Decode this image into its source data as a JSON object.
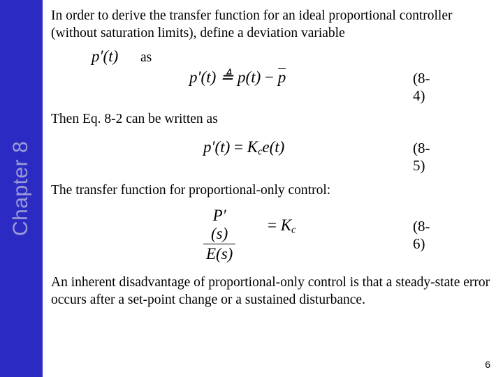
{
  "sidebar": {
    "chapter_label": "Chapter 8",
    "color": "#2b2bc4",
    "text_color": "#9a9ad8"
  },
  "slide": {
    "paragraph_1": "In order to derive the transfer function for an ideal proportional controller (without saturation limits), define a deviation variable",
    "inline_math_1": "p′(t)",
    "inline_word_1": "as",
    "paragraph_2": "Then Eq. 8-2 can be written as",
    "paragraph_3": "The transfer function for proportional-only control:",
    "paragraph_4": "An inherent disadvantage of proportional-only control is that a steady-state error occurs after a set-point change or a sustained disturbance.",
    "page_number": "6"
  },
  "equations": {
    "eq_8_4": {
      "lhs": "p′(t)",
      "operator": "≜",
      "rhs_term": "p(t)",
      "minus": "−",
      "rhs_bar": "p",
      "number": "(8-4)"
    },
    "eq_8_5": {
      "lhs": "p′(t)",
      "operator": "=",
      "rhs_coefficient": "K",
      "rhs_subscript": "c",
      "rhs_term": "e(t)",
      "number": "(8-5)"
    },
    "eq_8_6": {
      "numerator": "P′(s)",
      "denominator": "E(s)",
      "operator": "=",
      "rhs_coefficient": "K",
      "rhs_subscript": "c",
      "number": "(8-6)"
    }
  }
}
